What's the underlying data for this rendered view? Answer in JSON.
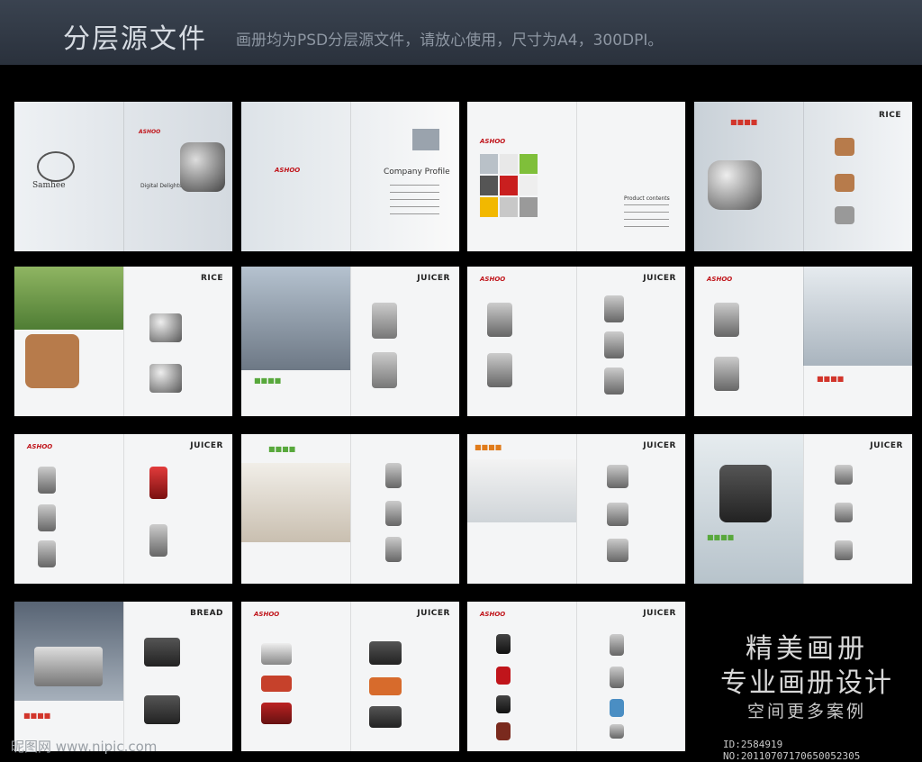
{
  "header": {
    "title": "分层源文件",
    "subtitle": "画册均为PSD分层源文件，请放心使用，尺寸为A4，300DPI。"
  },
  "spreads": [
    {
      "name": "cover-spread",
      "brand": "Samhee",
      "logo": "ASHOO",
      "left_text": "Digital Delights",
      "label": ""
    },
    {
      "name": "company-profile-spread",
      "logo": "ASHOO",
      "label": "Company Profile"
    },
    {
      "name": "contents-spread",
      "logo": "ASHOO",
      "label": "Product contents"
    },
    {
      "name": "rice-spread-1",
      "label": "RICE"
    },
    {
      "name": "rice-spread-2",
      "label": "RICE"
    },
    {
      "name": "juicer-spread-1",
      "label": "JUICER"
    },
    {
      "name": "juicer-spread-2",
      "label": "JUICER"
    },
    {
      "name": "juicer-spread-3",
      "label": ""
    },
    {
      "name": "juicer-spread-4",
      "label": "JUICER"
    },
    {
      "name": "juicer-spread-5",
      "label": ""
    },
    {
      "name": "juicer-spread-6",
      "label": "JUICER"
    },
    {
      "name": "juicer-spread-7",
      "label": "JUICER"
    },
    {
      "name": "bread-spread",
      "label": "BREAD"
    },
    {
      "name": "juicer-spread-8",
      "label": "JUICER"
    },
    {
      "name": "juicer-spread-9",
      "label": "JUICER"
    }
  ],
  "promo": {
    "line1": "精美画册",
    "line2": "专业画册设计",
    "line3": "空间更多案例"
  },
  "footer": {
    "watermark": "昵图网 www.nipic.com",
    "id_text": "ID:2584919 NO:20110707170650052305"
  }
}
